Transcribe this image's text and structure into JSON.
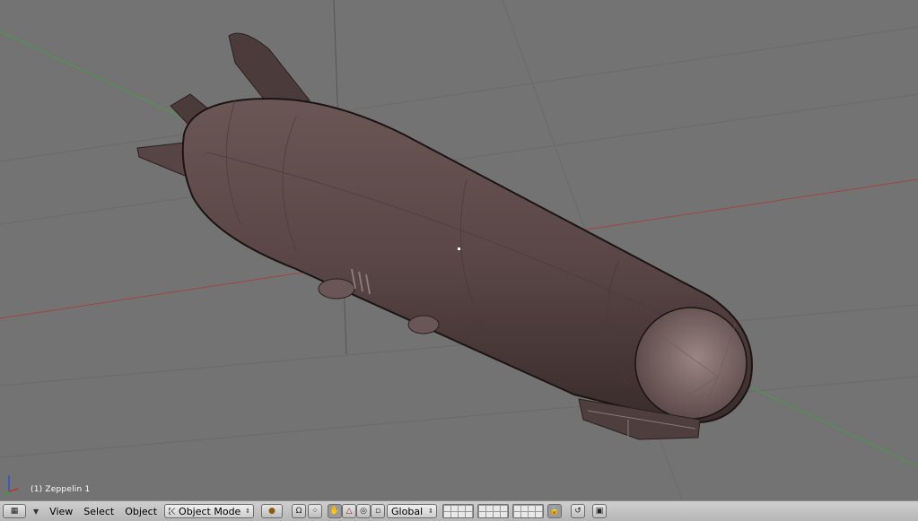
{
  "viewport": {
    "object_label": "(1) Zeppelin 1"
  },
  "header": {
    "menus": {
      "view": "View",
      "select": "Select",
      "object": "Object"
    },
    "mode_select": {
      "value": "Object Mode"
    },
    "orientation_select": {
      "value": "Global"
    }
  },
  "colors": {
    "viewport_bg": "#737373",
    "hull": "#5a4646",
    "axis_x": "#a04545",
    "axis_y": "#4a9a4a"
  },
  "icons": [
    "grid-icon",
    "triangle-down-icon",
    "paw-icon",
    "magnet-icon",
    "hand-icon",
    "rotate-icon",
    "scale-icon",
    "lock-icon",
    "render-icon",
    "axes-icon"
  ]
}
